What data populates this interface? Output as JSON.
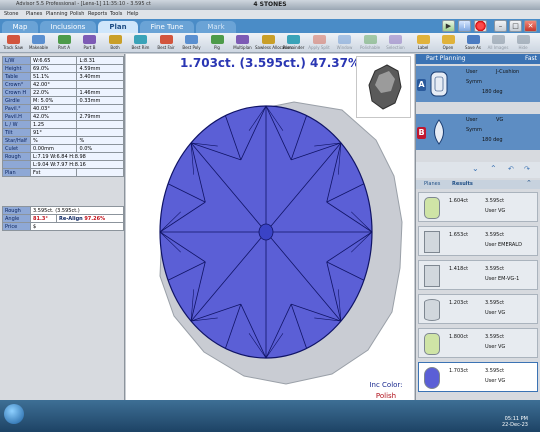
{
  "window": {
    "title": "4 STONES",
    "app_info": "Advisor 5.5 Professional - [Lens-1] 11:35:10 - 3.595 ct"
  },
  "menu": [
    "Stone",
    "Planes",
    "Planning",
    "Polish",
    "Reports",
    "Tools",
    "Help"
  ],
  "tabs": [
    {
      "label": "Map",
      "state": "inactive"
    },
    {
      "label": "Inclusions",
      "state": "inactive"
    },
    {
      "label": "Plan",
      "state": "active"
    },
    {
      "label": "Fine Tune",
      "state": "inactive"
    },
    {
      "label": "Mark",
      "state": "dim"
    }
  ],
  "toolbar": {
    "left": [
      {
        "label": "Track Saw",
        "icon": "saw-icon",
        "enabled": true
      },
      {
        "label": "Makeable",
        "icon": "makeable-icon",
        "enabled": true
      },
      {
        "label": "Part A",
        "icon": "part-a-icon",
        "enabled": true
      },
      {
        "label": "Part B",
        "icon": "part-b-icon",
        "enabled": true
      },
      {
        "label": "Both",
        "icon": "both-icon",
        "enabled": true
      },
      {
        "label": "Best Rim",
        "icon": "best-rim-icon",
        "enabled": true
      },
      {
        "label": "Best Fair",
        "icon": "best-fair-icon",
        "enabled": true
      },
      {
        "label": "Best Poly",
        "icon": "best-poly-icon",
        "enabled": true
      },
      {
        "label": "Pig",
        "icon": "pig-icon",
        "enabled": true
      },
      {
        "label": "Multiplan",
        "icon": "multiplan-icon",
        "enabled": true
      },
      {
        "label": "Sawless Allocation",
        "icon": "sawless-icon",
        "enabled": true
      },
      {
        "label": "Remainder",
        "icon": "remainder-icon",
        "enabled": true
      },
      {
        "label": "Apply Split",
        "icon": "apply-split-icon",
        "enabled": false
      },
      {
        "label": "Window",
        "icon": "window-icon",
        "enabled": false
      },
      {
        "label": "Polishable",
        "icon": "polishable-icon",
        "enabled": false
      },
      {
        "label": "Selection",
        "icon": "selection-icon",
        "enabled": false
      }
    ],
    "right": [
      {
        "label": "Label",
        "icon": "label-icon",
        "enabled": true
      },
      {
        "label": "Open",
        "icon": "open-icon",
        "enabled": true
      },
      {
        "label": "Save As",
        "icon": "save-as-icon",
        "enabled": true
      },
      {
        "label": "All Images",
        "icon": "images-icon",
        "enabled": false
      },
      {
        "label": "Hide",
        "icon": "hide-icon",
        "enabled": false
      }
    ]
  },
  "props": [
    {
      "label": "L/W",
      "a": "W:6.65",
      "b": "L:8.31"
    },
    {
      "label": "Height",
      "a": "69.0%",
      "b": "4.59mm"
    },
    {
      "label": "Table",
      "a": "51.1%",
      "b": "3.40mm"
    },
    {
      "label": "Crown°",
      "a": "42.00°",
      "b": ""
    },
    {
      "label": "Crown H",
      "a": "22.0%",
      "b": "1.46mm"
    },
    {
      "label": "Girdle",
      "a": "M: 5.0%",
      "b": "0.33mm"
    },
    {
      "label": "Pavil.°",
      "a": "40.03°",
      "b": ""
    },
    {
      "label": "Pavil.H",
      "a": "42.0%",
      "b": "2.79mm"
    },
    {
      "label": "L / W",
      "a": "1.25",
      "b": ""
    },
    {
      "label": "Tilt",
      "a": "91°",
      "b": ""
    },
    {
      "label": "Star/Half",
      "a": "%",
      "b": "%"
    },
    {
      "label": "Culet",
      "a": "0.00mm",
      "b": "0.0%"
    },
    {
      "label": "Rough",
      "a": "L:7.19 W:6.84 H:8.98",
      "b": ""
    },
    {
      "label": "",
      "a": "L:9.04 W:7.97 H:8.16",
      "b": ""
    },
    {
      "label": "Plan",
      "a": "Fst",
      "b": ""
    }
  ],
  "results": {
    "rough_label": "Rough",
    "rough_value": "3.595ct. (3.595ct.)",
    "angle_label": "Angle",
    "angle_value": "81.3°",
    "realign_label": "Re-Align",
    "realign_value": "97.26%",
    "price_label": "Price",
    "price_value": "$"
  },
  "view": {
    "headline": "1.703ct. (3.595ct.) 47.37%",
    "inc_color_label": "Inc Color:",
    "inc_color_value": "Polish"
  },
  "part_planning": {
    "title": "Part Planning",
    "mode": "Fast",
    "plans": [
      {
        "letter": "A",
        "user": "User",
        "shape": "J-Cushion",
        "symm": "Symm",
        "rotation": "180 deg",
        "color": "#2f62b0"
      },
      {
        "letter": "B",
        "user": "User",
        "shape": "VG",
        "symm": "Symm",
        "rotation": "180 deg",
        "color": "#c01830"
      }
    ]
  },
  "subtabs": [
    "Planes",
    "Results"
  ],
  "result_list": [
    {
      "ct": "1.604ct",
      "total": "3.595ct",
      "user": "User VG",
      "shape": "cushion"
    },
    {
      "ct": "1.653ct",
      "total": "3.595ct",
      "user": "User EMERALD",
      "shape": "emerald"
    },
    {
      "ct": "1.418ct",
      "total": "3.595ct",
      "user": "User EM-VG-1",
      "shape": "emerald"
    },
    {
      "ct": "1.203ct",
      "total": "3.595ct",
      "user": "User VG",
      "shape": "marquise"
    },
    {
      "ct": "1.800ct",
      "total": "3.595ct",
      "user": "User VG",
      "shape": "cushion"
    },
    {
      "ct": "1.703ct",
      "total": "3.595ct",
      "user": "User VG",
      "shape": "oval"
    }
  ],
  "taskbar": {
    "time": "05:11 PM",
    "date": "22-Dec-23"
  },
  "colors": {
    "gem_fill": "#5b5fd6",
    "gem_facet": "#101466",
    "rough_fill": "#c9ccd3",
    "accent": "#3b73b4"
  }
}
